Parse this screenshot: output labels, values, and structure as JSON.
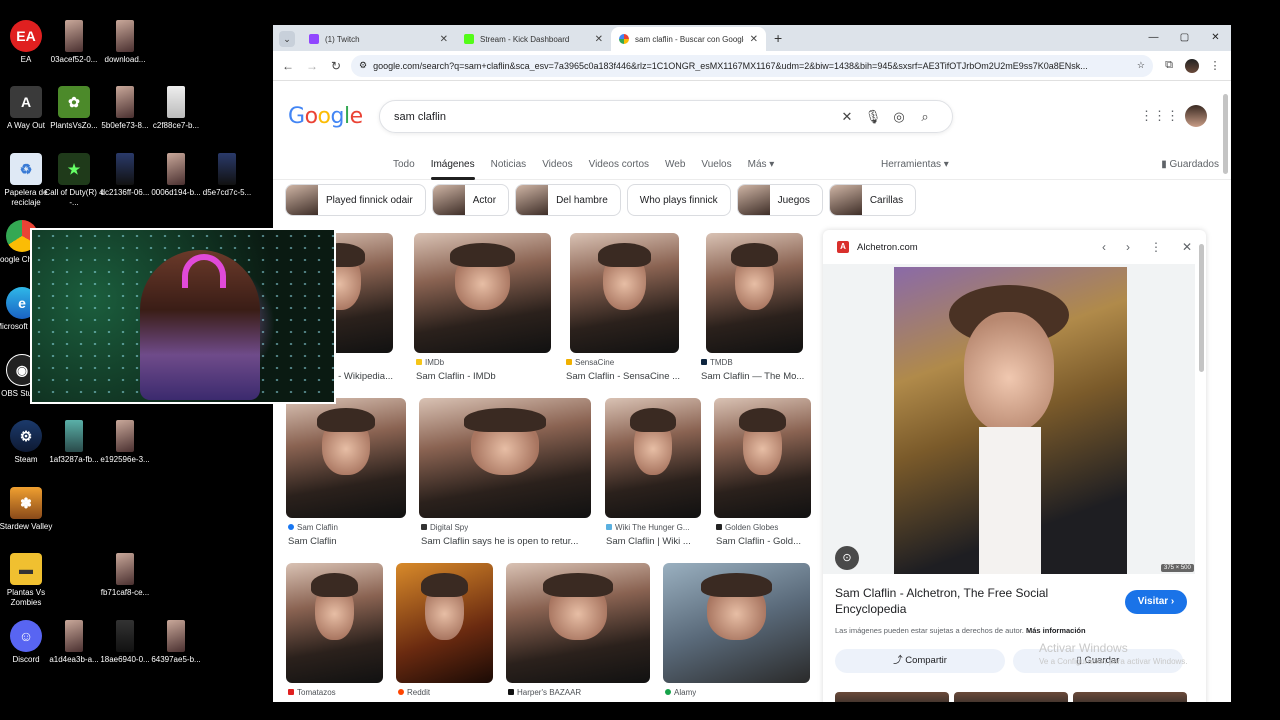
{
  "desktop": {
    "icons": [
      {
        "label": "EA"
      },
      {
        "label": "03acef52-0..."
      },
      {
        "label": "download..."
      },
      {
        "label": "A Way Out"
      },
      {
        "label": "PlantsVsZo..."
      },
      {
        "label": "5b0efe73-8..."
      },
      {
        "label": "c2f88ce7-b..."
      },
      {
        "label": "Papelera de reciclaje"
      },
      {
        "label": "Call of Duty(R) 4 -..."
      },
      {
        "label": "dc2136ff-06..."
      },
      {
        "label": "0006d194-b..."
      },
      {
        "label": "d5e7cd7c-5..."
      },
      {
        "label": "Google Chrome"
      },
      {
        "label": "Microsoft Edge"
      },
      {
        "label": "OBS Studio"
      },
      {
        "label": "Steam"
      },
      {
        "label": "1af3287a-fb..."
      },
      {
        "label": "e192596e-3..."
      },
      {
        "label": "Stardew Valley"
      },
      {
        "label": "Plantas Vs Zombies"
      },
      {
        "label": "fb71caf8-ce..."
      },
      {
        "label": "Discord"
      },
      {
        "label": "a1d4ea3b-a..."
      },
      {
        "label": "18ae6940-0..."
      },
      {
        "label": "64397ae5-b..."
      }
    ]
  },
  "browser": {
    "tabs": [
      {
        "title": "(1) Twitch",
        "color": "#9146ff"
      },
      {
        "title": "Stream - Kick Dashboard",
        "color": "#53fc18"
      },
      {
        "title": "sam claflin - Buscar con Google",
        "color": "#4285f4"
      }
    ],
    "url": "google.com/search?q=sam+claflin&sca_esv=7a3965c0a183f446&rlz=1C1ONGR_esMX1167MX1167&udm=2&biw=1438&bih=945&sxsrf=AE3TifOTJrbOm2U2mE9ss7K0a8ENsk..."
  },
  "google": {
    "logo": "Google",
    "query": "sam claflin",
    "nav": [
      "Todo",
      "Imágenes",
      "Noticias",
      "Videos",
      "Videos cortos",
      "Web",
      "Vuelos",
      "Más ▾"
    ],
    "tools": "Herramientas ▾",
    "saved": "Guardados",
    "chips": [
      "Played finnick odair",
      "Actor",
      "Del hambre",
      "Who plays finnick",
      "Juegos",
      "Carillas"
    ],
    "results": [
      {
        "source": "",
        "caption": "- Wikipedia..."
      },
      {
        "source": "IMDb",
        "caption": "Sam Claflin - IMDb"
      },
      {
        "source": "SensaCine",
        "caption": "Sam Claflin - SensaCine ..."
      },
      {
        "source": "TMDB",
        "caption": "Sam Claflin — The Mo..."
      },
      {
        "source": "Sam Claflin",
        "caption": "Sam Claflin"
      },
      {
        "source": "Digital Spy",
        "caption": "Sam Claflin says he is open to retur..."
      },
      {
        "source": "Wiki The Hunger G...",
        "caption": "Sam Claflin | Wiki ..."
      },
      {
        "source": "Golden Globes",
        "caption": "Sam Claflin - Gold..."
      },
      {
        "source": "Tomatazos",
        "caption": ""
      },
      {
        "source": "Reddit",
        "caption": ""
      },
      {
        "source": "Harper's BAZAAR",
        "caption": ""
      },
      {
        "source": "Alamy",
        "caption": ""
      }
    ],
    "panel": {
      "site": "Alchetron.com",
      "site_letter": "A",
      "dimensions": "375 × 500",
      "title": "Sam Claflin - Alchetron, The Free Social Encyclopedia",
      "visit": "Visitar",
      "notice": "Las imágenes pueden estar sujetas a derechos de autor.",
      "more_info": "Más información",
      "share": "Compartir",
      "save": "Guardar"
    }
  },
  "watermark": {
    "line1": "Activar Windows",
    "line2": "Ve a Configuración para activar Windows."
  },
  "colors": {
    "accent": "#1a73e8",
    "tabstrip": "#dde3ea",
    "omnibox": "#edf2fa"
  }
}
